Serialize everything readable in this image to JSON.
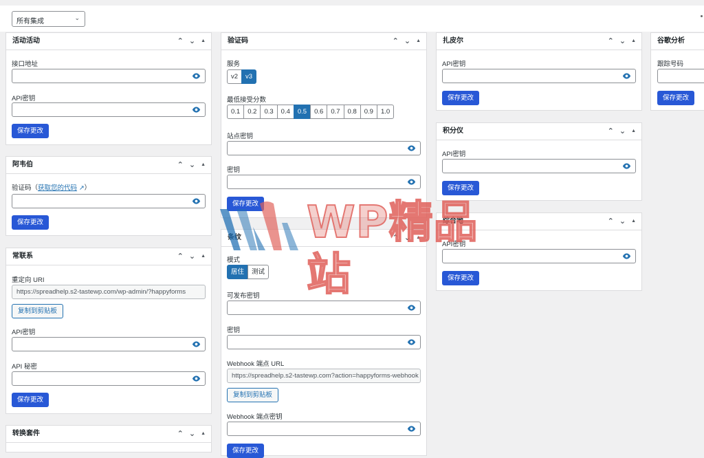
{
  "filter": {
    "selected": "所有集成"
  },
  "common": {
    "save": "保存更改",
    "copy": "复制到剪贴板",
    "api_key": "API密钥",
    "secret": "密钥"
  },
  "panels": {
    "activecampaign": {
      "title": "活动活动",
      "endpoint_label": "接口地址",
      "api_key_label": "API密钥"
    },
    "aweber": {
      "title": "阿韦伯",
      "code_label": "验证码",
      "code_link": "获取您的代码"
    },
    "constantcontact": {
      "title": "常联系",
      "redirect_label": "重定向 URI",
      "redirect_value": "https://spreadhelp.s2-tastewp.com/wp-admin/?happyforms",
      "api_key_label": "API密钥",
      "api_secret_label": "API 秘密"
    },
    "convertkit": {
      "title": "转换套件"
    },
    "captcha": {
      "title": "验证码",
      "service_label": "服务",
      "service_options": [
        "v2",
        "v3"
      ],
      "service_selected": "v3",
      "score_label": "最低接受分数",
      "score_options": [
        "0.1",
        "0.2",
        "0.3",
        "0.4",
        "0.5",
        "0.6",
        "0.7",
        "0.8",
        "0.9",
        "1.0"
      ],
      "score_selected": "0.5",
      "site_key_label": "站点密钥",
      "secret_label": "密钥"
    },
    "stripe": {
      "title": "条纹",
      "mode_label": "模式",
      "mode_options": [
        "居住",
        "测试"
      ],
      "mode_selected": "居住",
      "publishable_label": "可发布密钥",
      "secret_label": "密钥",
      "webhook_url_label": "Webhook 端点 URL",
      "webhook_url_value": "https://spreadhelp.s2-tastewp.com?action=happyforms-webhook",
      "webhook_secret_label": "Webhook 端点密钥"
    },
    "zapier": {
      "title": "扎皮尔",
      "api_key_label": "API密钥"
    },
    "integrately": {
      "title": "积分仪",
      "api_key_label": "API密钥"
    },
    "zoho": {
      "title": "综合地",
      "api_key_label": "API密钥"
    },
    "google_analytics": {
      "title": "谷歌分析",
      "tracking_label": "跟踪号码"
    }
  },
  "watermark": {
    "text": "WP精品站"
  },
  "colors": {
    "primary_button": "#2858d6",
    "link": "#2271b1",
    "watermark": "#e0605a"
  }
}
